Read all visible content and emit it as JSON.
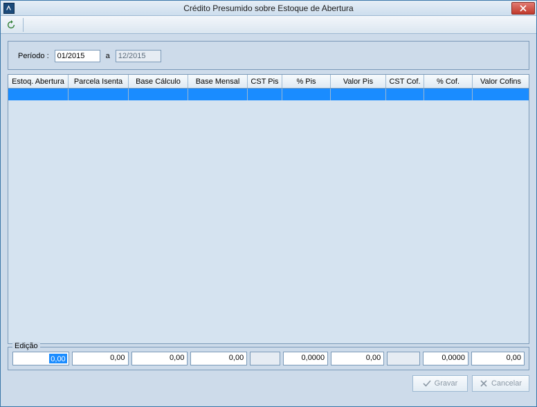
{
  "window": {
    "title": "Crédito Presumido sobre Estoque de Abertura"
  },
  "period": {
    "label": "Período :",
    "separator": "a",
    "start": "01/2015",
    "end": "12/2015"
  },
  "grid": {
    "columns": [
      "Estoq. Abertura",
      "Parcela Isenta",
      "Base Cálculo",
      "Base Mensal",
      "CST Pis",
      "% Pis",
      "Valor Pis",
      "CST Cof.",
      "% Cof.",
      "Valor Cofins"
    ]
  },
  "edit": {
    "legend": "Edição",
    "fields": [
      "0,00",
      "0,00",
      "0,00",
      "0,00",
      "",
      "0,0000",
      "0,00",
      "",
      "0,0000",
      "0,00"
    ]
  },
  "buttons": {
    "save": "Gravar",
    "cancel": "Cancelar"
  }
}
